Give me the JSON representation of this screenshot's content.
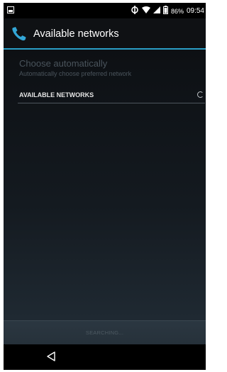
{
  "status_bar": {
    "battery_percent": "86%",
    "time": "09:54",
    "icons": [
      "notification-icon",
      "sync-icon",
      "wifi-icon",
      "signal-icon",
      "battery-icon"
    ]
  },
  "action_bar": {
    "title": "Available networks",
    "icon": "phone-icon"
  },
  "preference": {
    "title": "Choose automatically",
    "summary": "Automatically choose preferred network"
  },
  "section": {
    "label": "AVAILABLE NETWORKS"
  },
  "search": {
    "label": "SEARCHING..."
  },
  "navigation": {
    "back_icon": "back-icon"
  },
  "colors": {
    "accent": "#2b9fc6",
    "disabled_text": "#4a545c"
  }
}
